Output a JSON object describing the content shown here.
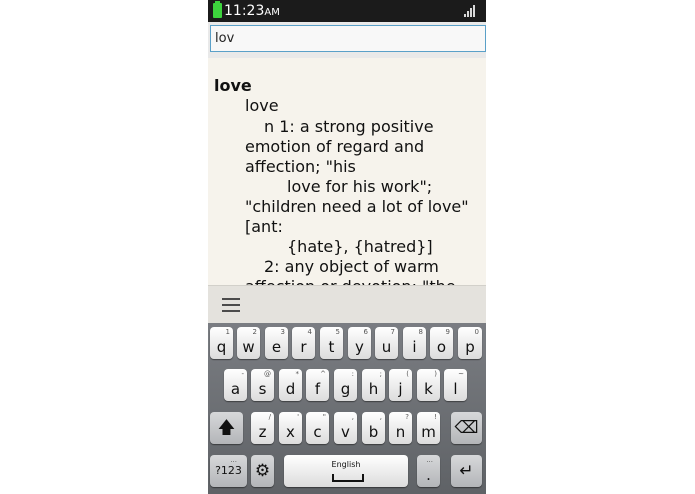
{
  "status_bar": {
    "time": "11:23",
    "ampm": "AM"
  },
  "search": {
    "value": "lov"
  },
  "definition": {
    "headword": "love",
    "lines": [
      "love",
      "n 1: a strong positive",
      "emotion of regard and",
      "affection; \"his",
      "love for his work\";",
      "\"children need a lot of love\"",
      "[ant:",
      "{hate}, {hatred}]",
      "2: any object of warm",
      "affection or devotion; \"the"
    ]
  },
  "toolbar": {
    "menu_icon": "menu-icon"
  },
  "keyboard": {
    "row1": [
      {
        "key": "q",
        "hint": "1"
      },
      {
        "key": "w",
        "hint": "2"
      },
      {
        "key": "e",
        "hint": "3"
      },
      {
        "key": "r",
        "hint": "4"
      },
      {
        "key": "t",
        "hint": "5"
      },
      {
        "key": "y",
        "hint": "6"
      },
      {
        "key": "u",
        "hint": "7"
      },
      {
        "key": "i",
        "hint": "8"
      },
      {
        "key": "o",
        "hint": "9"
      },
      {
        "key": "p",
        "hint": "0"
      }
    ],
    "row2": [
      {
        "key": "a",
        "hint": "-"
      },
      {
        "key": "s",
        "hint": "@"
      },
      {
        "key": "d",
        "hint": "*"
      },
      {
        "key": "f",
        "hint": "^"
      },
      {
        "key": "g",
        "hint": ":"
      },
      {
        "key": "h",
        "hint": ";"
      },
      {
        "key": "j",
        "hint": "("
      },
      {
        "key": "k",
        "hint": ")"
      },
      {
        "key": "l",
        "hint": "~"
      }
    ],
    "row3": [
      {
        "key": "z",
        "hint": "/"
      },
      {
        "key": "x",
        "hint": "'"
      },
      {
        "key": "c",
        "hint": "\""
      },
      {
        "key": "v",
        "hint": ","
      },
      {
        "key": "b",
        "hint": ","
      },
      {
        "key": "n",
        "hint": "?"
      },
      {
        "key": "m",
        "hint": "!"
      }
    ],
    "shift_icon": "shift-arrow-icon",
    "backspace_icon": "backspace-icon",
    "symbols_label": "?123",
    "symbols_hint": "...",
    "settings_icon": "gear-icon",
    "space_label": "English",
    "period_label": ".",
    "period_hint": "...",
    "enter_icon": "enter-icon"
  }
}
